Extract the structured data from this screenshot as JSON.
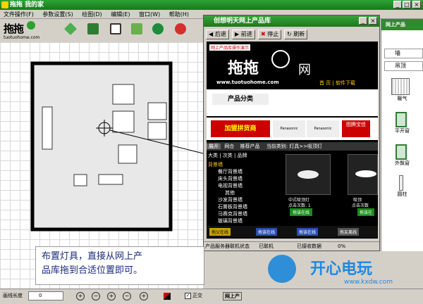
{
  "app": {
    "title": "拖拖 我的家"
  },
  "window_controls": [
    "_",
    "□",
    "×"
  ],
  "menu": [
    "文件操作(F)",
    "参数设置(S)",
    "绘图(D)",
    "编辑(E)",
    "窗口(W)",
    "帮助(H)"
  ],
  "logo": {
    "text": "拖拖",
    "url": "tuotuohome.com"
  },
  "popup": {
    "title": "创想明天网上产品库",
    "toolbar": {
      "back": "后退",
      "forward": "前进",
      "stop": "停止",
      "refresh": "刷新"
    },
    "web": {
      "demo_link": "网上产品库操作演示",
      "brand": "拖拖",
      "brand_suffix": "网",
      "url": "www.tuotuohome.com",
      "nav": "首 页 | 软件下载",
      "category_header": "产品分类",
      "ads": [
        "加盟拼货商",
        "Panasonic",
        "Panasonic",
        "图腾宝佳"
      ],
      "tabs": [
        "展开",
        "网合",
        "推荐产品"
      ],
      "breadcrumb": "当前类别: 灯具>>吸顶灯",
      "tree_header": [
        "大类",
        "次类",
        "品牌"
      ],
      "tree": [
        "背景墙",
        "餐厅背景墙",
        "床头背景墙",
        "电视背景墙",
        "其他",
        "沙发背景墙",
        "石膏板背景墙",
        "马赛克背景墙",
        "玻璃背景墙"
      ],
      "products": [
        {
          "name": "中式吸顶灯",
          "clicks": "点击次数: 1",
          "button": "拖该在线"
        },
        {
          "name": "吸顶",
          "clicks": "点击次数",
          "button": "拖该在"
        }
      ],
      "bottom_buttons": [
        "拖父在线",
        "拖该在线",
        "拖该在线",
        "拖友离线"
      ]
    },
    "status": {
      "service": "产品服务器联机状态",
      "connected": "已联机",
      "received": "已接收数据",
      "percent": "0%"
    }
  },
  "right_panel": {
    "header": "网上产品",
    "tabs": [
      "墙",
      "吊顶"
    ],
    "items": [
      "暖气",
      "平开窗",
      "外飘窗",
      "圆柱"
    ]
  },
  "caption": {
    "line1": "布置灯具，直接从网上产",
    "line2": "品库拖到合适位置即可。"
  },
  "statusbar": {
    "label": "画线长度",
    "value": "0",
    "ortho": "正交"
  },
  "watermark": {
    "brand": "开心电玩",
    "url": "www.kxdw.com"
  },
  "taskbar_label": "网上产"
}
